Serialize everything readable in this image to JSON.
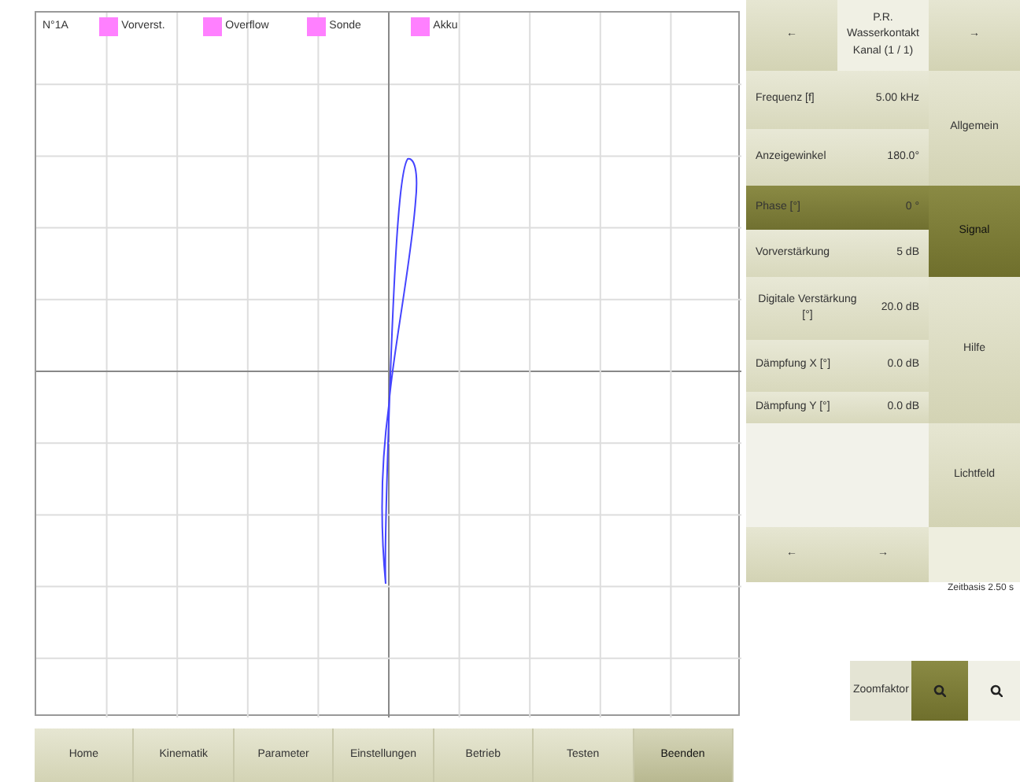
{
  "plot": {
    "label": "N°1A",
    "legend": [
      {
        "label": "Vorverst."
      },
      {
        "label": "Overflow"
      },
      {
        "label": "Sonde"
      },
      {
        "label": "Akku"
      }
    ]
  },
  "panel": {
    "prev": "←",
    "title": "P.R. Wasserkontakt Kanal (1 / 1)",
    "next": "→",
    "params": [
      {
        "label": "Frequenz [f]",
        "value": "5.00 kHz",
        "selected": false
      },
      {
        "label": "Anzeigewinkel",
        "value": "180.0°",
        "selected": false
      },
      {
        "label": "Phase [°]",
        "value": "0 °",
        "selected": true
      },
      {
        "label": "Vorverstärkung",
        "value": "5 dB",
        "selected": false
      },
      {
        "label": "Digitale Verstärkung [°]",
        "value": "20.0 dB",
        "selected": false
      },
      {
        "label": "Dämpfung X [°]",
        "value": "0.0 dB",
        "selected": false
      },
      {
        "label": "Dämpfung Y [°]",
        "value": "0.0 dB",
        "selected": false
      }
    ],
    "page_prev": "←",
    "page_next": "→",
    "groups": [
      {
        "label": "Allgemein",
        "selected": false
      },
      {
        "label": "Signal",
        "selected": true
      },
      {
        "label": "Hilfe",
        "selected": false
      },
      {
        "label": "Lichtfeld",
        "selected": false
      }
    ]
  },
  "timebase": "Zeitbasis 2.50 s",
  "zoom": {
    "label": "Zoomfaktor"
  },
  "tabs": [
    {
      "label": "Home",
      "selected": false
    },
    {
      "label": "Kinematik",
      "selected": false
    },
    {
      "label": "Parameter",
      "selected": false
    },
    {
      "label": "Einstellungen",
      "selected": false
    },
    {
      "label": "Betrieb",
      "selected": false
    },
    {
      "label": "Testen",
      "selected": false
    },
    {
      "label": "Beenden",
      "selected": true
    }
  ]
}
